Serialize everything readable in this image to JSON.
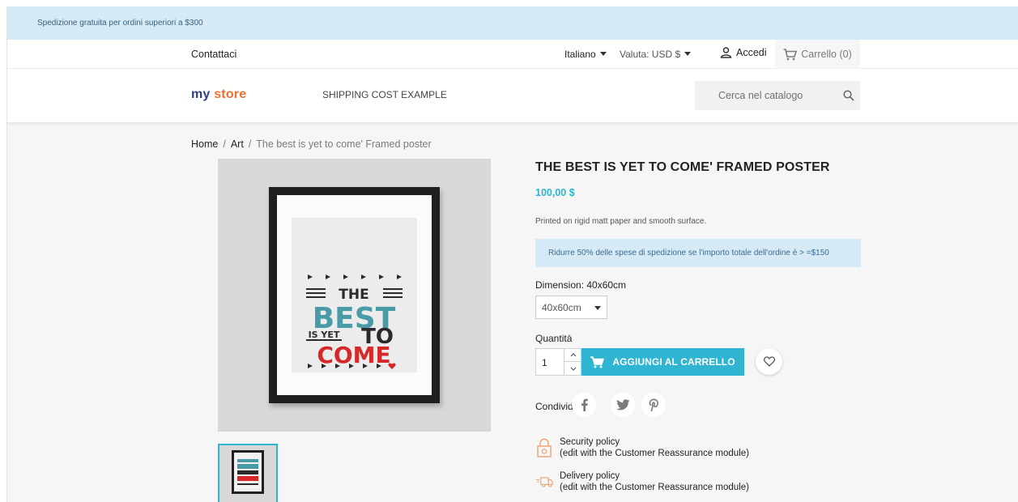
{
  "banner": {
    "text": "Spedizione gratuita per ordini superiori a $300"
  },
  "topnav": {
    "contact": "Contattaci",
    "language": "Italiano",
    "currency": "Valuta: USD $",
    "login": "Accedi",
    "cart": "Carrello (0)"
  },
  "header": {
    "logo_part1": "my",
    "logo_part2": "store",
    "menu_link": "SHIPPING COST EXAMPLE",
    "search_placeholder": "Cerca nel catalogo"
  },
  "breadcrumb": {
    "items": [
      "Home",
      "Art",
      "The best is yet to come' Framed poster"
    ]
  },
  "poster": {
    "line1": "THE",
    "line2": "BEST",
    "line3a": "IS YET",
    "line3b": "TO",
    "line4": "COME"
  },
  "product": {
    "title": "THE BEST IS YET TO COME' FRAMED POSTER",
    "price": "100,00 $",
    "description": "Printed on rigid matt paper and smooth surface.",
    "notice": "Ridurre 50% delle spese di spedizione se l'importo totale dell'ordine è > =$150",
    "dimension_label": "Dimension: 40x60cm",
    "dimension_selected": "40x60cm",
    "quantity_label": "Quantità",
    "quantity_value": "1",
    "add_to_cart": "AGGIUNGI AL CARRELLO",
    "share_label": "Condividi"
  },
  "reassurance": [
    {
      "title": "Security policy",
      "subtitle": "(edit with the Customer Reassurance module)"
    },
    {
      "title": "Delivery policy",
      "subtitle": "(edit with the Customer Reassurance module)"
    }
  ],
  "colors": {
    "accent": "#2fb5d2",
    "banner_bg": "#d6eaf6",
    "logo_blue": "#2f3c86",
    "logo_orange": "#ee6e2e",
    "poster_teal": "#4a9ba8",
    "poster_red": "#d62828"
  },
  "icons": [
    "user-icon",
    "cart-icon",
    "search-icon",
    "cart-add-icon",
    "heart-icon",
    "facebook-icon",
    "twitter-icon",
    "pinterest-icon",
    "lock-icon",
    "truck-icon"
  ]
}
